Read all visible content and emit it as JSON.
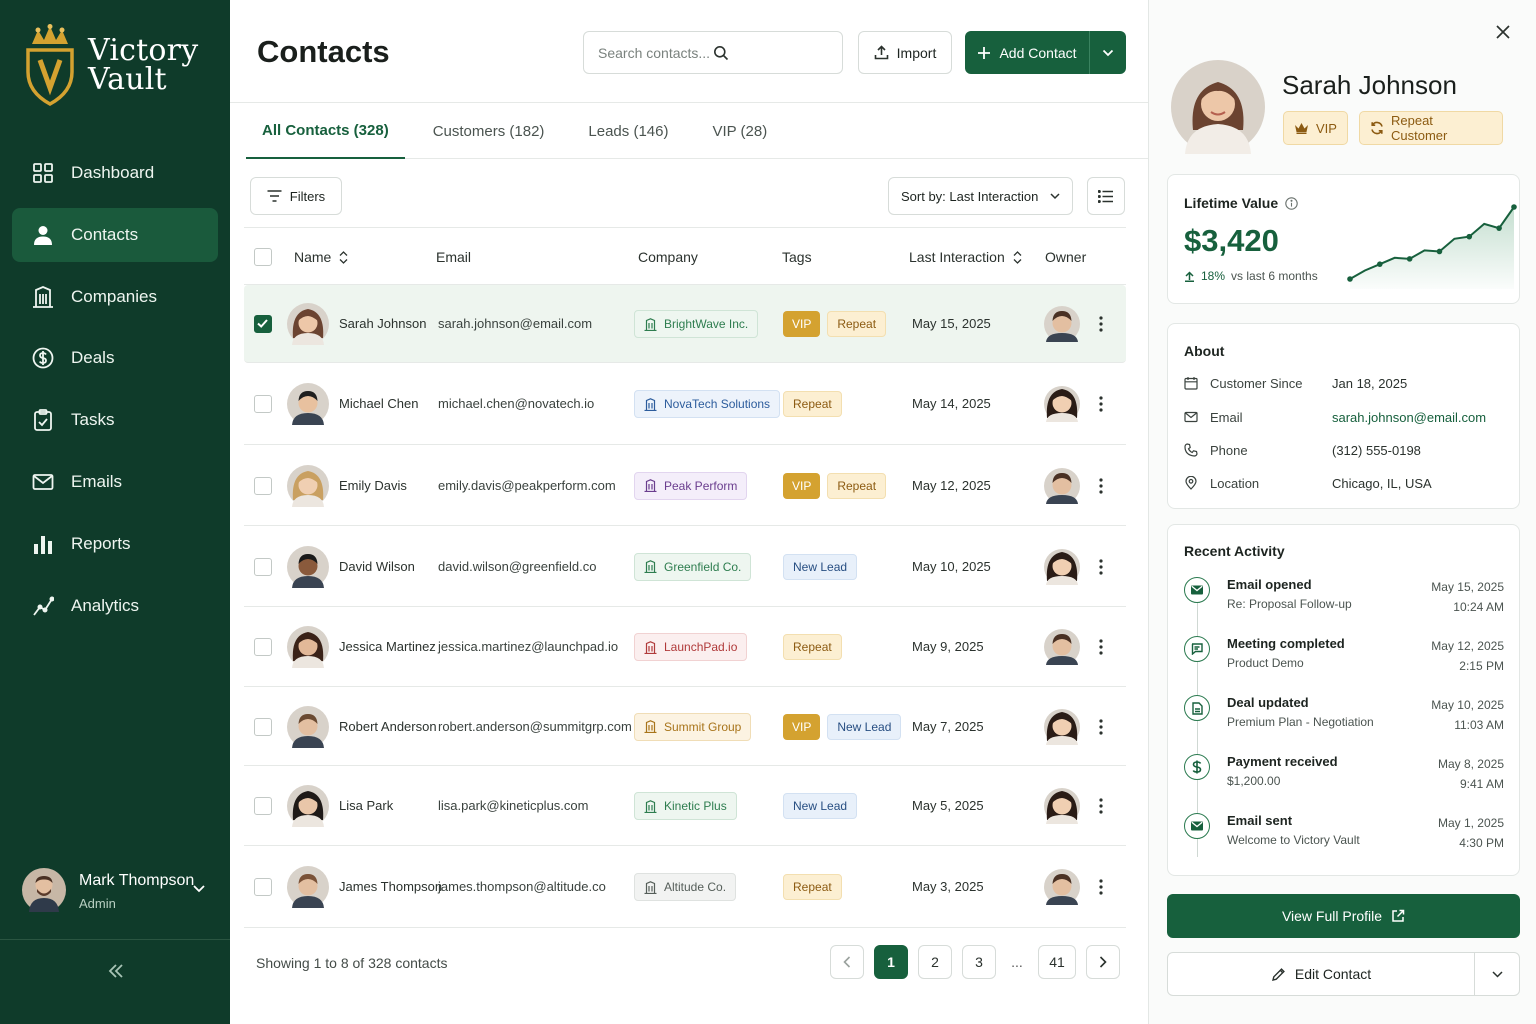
{
  "brand": {
    "line1": "Victory",
    "line2": "Vault"
  },
  "nav": [
    {
      "label": "Dashboard",
      "icon": "grid-icon"
    },
    {
      "label": "Contacts",
      "icon": "person-icon",
      "active": true
    },
    {
      "label": "Companies",
      "icon": "building-icon"
    },
    {
      "label": "Deals",
      "icon": "dollar-icon"
    },
    {
      "label": "Tasks",
      "icon": "clipboard-icon"
    },
    {
      "label": "Emails",
      "icon": "mail-icon"
    },
    {
      "label": "Reports",
      "icon": "bar-chart-icon"
    },
    {
      "label": "Analytics",
      "icon": "trend-icon"
    }
  ],
  "user": {
    "name": "Mark Thompson",
    "role": "Admin"
  },
  "header": {
    "title": "Contacts",
    "search_placeholder": "Search contacts...",
    "import_label": "Import",
    "add_label": "Add Contact"
  },
  "tabs": [
    {
      "label": "All Contacts (328)",
      "active": true
    },
    {
      "label": "Customers (182)"
    },
    {
      "label": "Leads (146)"
    },
    {
      "label": "VIP (28)"
    }
  ],
  "toolbar": {
    "filters_label": "Filters",
    "sort_label": "Sort by: Last Interaction"
  },
  "table": {
    "columns": {
      "name": "Name",
      "email": "Email",
      "company": "Company",
      "tags": "Tags",
      "last": "Last Interaction",
      "owner": "Owner"
    },
    "rows": [
      {
        "name": "Sarah Johnson",
        "email": "sarah.johnson@email.com",
        "company": "BrightWave Inc.",
        "company_color": "#2e7d4f",
        "tags": [
          "VIP",
          "Repeat"
        ],
        "date": "May 15, 2025",
        "checked": true
      },
      {
        "name": "Michael Chen",
        "email": "michael.chen@novatech.io",
        "company": "NovaTech Solutions",
        "company_color": "#2c5c9c",
        "tags": [
          "Repeat"
        ],
        "date": "May 14, 2025",
        "checked": false
      },
      {
        "name": "Emily Davis",
        "email": "emily.davis@peakperform.com",
        "company": "Peak Perform",
        "company_color": "#6a3d8e",
        "tags": [
          "VIP",
          "Repeat"
        ],
        "date": "May 12, 2025",
        "checked": false
      },
      {
        "name": "David Wilson",
        "email": "david.wilson@greenfield.co",
        "company": "Greenfield Co.",
        "company_color": "#2e7d4f",
        "tags": [
          "New Lead"
        ],
        "date": "May 10, 2025",
        "checked": false
      },
      {
        "name": "Jessica Martinez",
        "email": "jessica.martinez@launchpad.io",
        "company": "LaunchPad.io",
        "company_color": "#b03a3a",
        "tags": [
          "Repeat"
        ],
        "date": "May 9, 2025",
        "checked": false
      },
      {
        "name": "Robert Anderson",
        "email": "robert.anderson@summitgrp.com",
        "company": "Summit Group",
        "company_color": "#a8741a",
        "tags": [
          "VIP",
          "New Lead"
        ],
        "date": "May 7, 2025",
        "checked": false
      },
      {
        "name": "Lisa Park",
        "email": "lisa.park@kineticplus.com",
        "company": "Kinetic Plus",
        "company_color": "#2e7d4f",
        "tags": [
          "New Lead"
        ],
        "date": "May 5, 2025",
        "checked": false
      },
      {
        "name": "James Thompson",
        "email": "james.thompson@altitude.co",
        "company": "Altitude Co.",
        "company_color": "#555e59",
        "tags": [
          "Repeat"
        ],
        "date": "May 3, 2025",
        "checked": false
      }
    ]
  },
  "footer": {
    "showing": "Showing 1 to 8 of 328 contacts",
    "pages": [
      "1",
      "2",
      "3",
      "...",
      "41"
    ],
    "current": "1"
  },
  "panel": {
    "name": "Sarah Johnson",
    "badges": [
      "VIP",
      "Repeat Customer"
    ],
    "lifetime": {
      "title": "Lifetime Value",
      "amount": "$3,420",
      "growth": "18%",
      "growth_suffix": "vs last 6 months",
      "trend": [
        10,
        18,
        24,
        30,
        29,
        37,
        36,
        48,
        50,
        62,
        58,
        78
      ]
    },
    "about": {
      "title": "About",
      "rows": [
        {
          "label": "Customer Since",
          "value": "Jan 18, 2025",
          "icon": "calendar-icon"
        },
        {
          "label": "Email",
          "value": "sarah.johnson@email.com",
          "icon": "mail-icon",
          "link": true
        },
        {
          "label": "Phone",
          "value": "(312) 555-0198",
          "icon": "phone-icon"
        },
        {
          "label": "Location",
          "value": "Chicago, IL, USA",
          "icon": "pin-icon"
        }
      ]
    },
    "activity": {
      "title": "Recent Activity",
      "items": [
        {
          "title": "Email opened",
          "sub": "Re: Proposal Follow-up",
          "date": "May 15, 2025",
          "time": "10:24 AM",
          "icon": "mail-icon"
        },
        {
          "title": "Meeting completed",
          "sub": "Product Demo",
          "date": "May 12, 2025",
          "time": "2:15 PM",
          "icon": "chat-icon"
        },
        {
          "title": "Deal updated",
          "sub": "Premium Plan - Negotiation",
          "date": "May 10, 2025",
          "time": "11:03 AM",
          "icon": "document-icon"
        },
        {
          "title": "Payment received",
          "sub": "$1,200.00",
          "date": "May 8, 2025",
          "time": "9:41 AM",
          "icon": "dollar-icon"
        },
        {
          "title": "Email sent",
          "sub": "Welcome to Victory Vault",
          "date": "May 1, 2025",
          "time": "4:30 PM",
          "icon": "mail-icon"
        }
      ]
    },
    "view_profile_label": "View Full Profile",
    "edit_label": "Edit Contact"
  },
  "colors": {
    "brand_dark": "#0f3b2a",
    "accent": "#17603d",
    "vip": "#d4a230"
  }
}
